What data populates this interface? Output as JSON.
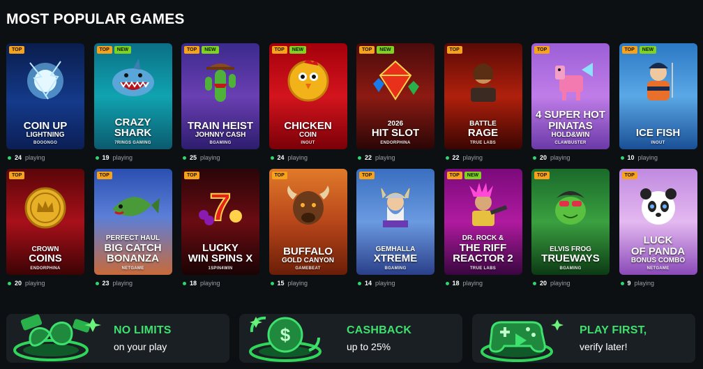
{
  "section_title": "MOST POPULAR GAMES",
  "games": [
    {
      "lines": [
        {
          "t": "COIN UP",
          "s": "lg"
        },
        {
          "t": "LIGHTNING",
          "s": "sm"
        }
      ],
      "provider": "BOOONGO",
      "players": "24",
      "badges": [
        "TOP"
      ],
      "bg": "linear-gradient(180deg,#0a1d4d,#143a8a 55%,#0b1e55)",
      "art": "lightning",
      "icon": "lightning-orb-icon"
    },
    {
      "lines": [
        {
          "t": "CRAZY",
          "s": "lg"
        },
        {
          "t": "SHARK",
          "s": "lg"
        }
      ],
      "provider": "7RINGS GAMING",
      "players": "19",
      "badges": [
        "TOP",
        "NEW"
      ],
      "bg": "linear-gradient(180deg,#0b6f86,#10a3b0 50%,#0b5a6e)",
      "art": "shark",
      "icon": "shark-icon"
    },
    {
      "lines": [
        {
          "t": "TRAIN HEIST",
          "s": "lg"
        },
        {
          "t": "JOHNNY CASH",
          "s": "sm"
        }
      ],
      "provider": "BGAMING",
      "players": "25",
      "badges": [
        "TOP",
        "NEW"
      ],
      "bg": "linear-gradient(180deg,#3b2a8c,#6a3fb2 50%,#2d1d6e)",
      "art": "cactus",
      "icon": "cactus-cowboy-icon"
    },
    {
      "lines": [
        {
          "t": "CHICKEN",
          "s": "lg"
        },
        {
          "t": "COIN",
          "s": "sm"
        }
      ],
      "provider": "INOUT",
      "players": "24",
      "badges": [
        "TOP",
        "NEW"
      ],
      "bg": "linear-gradient(180deg,#a3000c,#d4141d 50%,#7a0008)",
      "art": "chicken",
      "icon": "chicken-coin-icon"
    },
    {
      "lines": [
        {
          "t": "2026",
          "s": "sm"
        },
        {
          "t": "HIT SLOT",
          "s": "lg"
        }
      ],
      "provider": "ENDORPHINA",
      "players": "22",
      "badges": [
        "TOP",
        "NEW"
      ],
      "bg": "linear-gradient(180deg,#4a0b0b,#8c1a12 50%,#2a0606)",
      "art": "gems",
      "icon": "diamond-gems-icon"
    },
    {
      "lines": [
        {
          "t": "BATTLE",
          "s": "sm"
        },
        {
          "t": "RAGE",
          "s": "lg"
        }
      ],
      "provider": "TRUE LABS",
      "players": "22",
      "badges": [
        "TOP"
      ],
      "bg": "linear-gradient(180deg,#5a0a06,#b0200c 50%,#3a0502)",
      "art": "warrior",
      "icon": "warrior-icon"
    },
    {
      "lines": [
        {
          "t": "4 SUPER HOT",
          "s": "lg"
        },
        {
          "t": "PINATAS",
          "s": "lg"
        },
        {
          "t": "HOLD&WIN",
          "s": "sm"
        }
      ],
      "provider": "CLAWBUSTER",
      "players": "20",
      "badges": [
        "TOP"
      ],
      "bg": "linear-gradient(180deg,#9b5fd6,#c07de8 50%,#6a3aa8)",
      "art": "pinata",
      "icon": "pinata-icon"
    },
    {
      "lines": [
        {
          "t": "ICE FISH",
          "s": "lg"
        }
      ],
      "provider": "INOUT",
      "players": "10",
      "badges": [
        "TOP",
        "NEW"
      ],
      "bg": "linear-gradient(180deg,#2b78c4,#5aa8e6 50%,#1a4f96)",
      "art": "icefish",
      "icon": "ice-fisher-icon"
    },
    {
      "lines": [
        {
          "t": "CROWN",
          "s": "sm"
        },
        {
          "t": "COINS",
          "s": "lg"
        }
      ],
      "provider": "ENDORPHINA",
      "players": "20",
      "badges": [
        "TOP"
      ],
      "bg": "linear-gradient(180deg,#5a0608,#a8101a 50%,#3c0304)",
      "art": "crowncoin",
      "icon": "crown-coin-icon"
    },
    {
      "lines": [
        {
          "t": "PERFECT HAUL",
          "s": "sm"
        },
        {
          "t": "BIG CATCH",
          "s": "lg"
        },
        {
          "t": "BONANZA",
          "s": "lg"
        }
      ],
      "provider": "NETGAME",
      "players": "23",
      "badges": [
        "TOP"
      ],
      "bg": "linear-gradient(180deg,#2a4fb0,#5b7fd8 45%,#c86a3a)",
      "art": "fish",
      "icon": "bass-fish-icon"
    },
    {
      "lines": [
        {
          "t": "LUCKY",
          "s": "lg"
        },
        {
          "t": "WIN SPINS X",
          "s": "lg"
        }
      ],
      "provider": "1SPIN4WIN",
      "players": "18",
      "badges": [
        "TOP"
      ],
      "bg": "linear-gradient(180deg,#2a0508,#6a0c12 50%,#1a0304)",
      "art": "seven",
      "icon": "lucky-seven-icon"
    },
    {
      "lines": [
        {
          "t": "BUFFALO",
          "s": "lg"
        },
        {
          "t": "GOLD CANYON",
          "s": "sm"
        }
      ],
      "provider": "GAMEBEAT",
      "players": "15",
      "badges": [
        "TOP"
      ],
      "bg": "linear-gradient(180deg,#e07a2a,#b8461a 50%,#6a1e08)",
      "art": "buffalo",
      "icon": "buffalo-icon"
    },
    {
      "lines": [
        {
          "t": "GEMHALLA",
          "s": "sm"
        },
        {
          "t": "XTREME",
          "s": "lg"
        }
      ],
      "provider": "BGAMING",
      "players": "14",
      "badges": [
        "TOP"
      ],
      "bg": "linear-gradient(180deg,#3a6fc0,#6a9ae0 50%,#2a3f8a)",
      "art": "viking",
      "icon": "viking-icon"
    },
    {
      "lines": [
        {
          "t": "DR. ROCK &",
          "s": "sm"
        },
        {
          "t": "THE RIFF",
          "s": "lg"
        },
        {
          "t": "REACTOR 2",
          "s": "lg"
        }
      ],
      "provider": "TRUE LABS",
      "players": "18",
      "badges": [
        "TOP",
        "NEW"
      ],
      "bg": "linear-gradient(180deg,#7a0a7a,#b01aa0 50%,#3a0640)",
      "art": "rocker",
      "icon": "rocker-icon"
    },
    {
      "lines": [
        {
          "t": "ELVIS FROG",
          "s": "sm"
        },
        {
          "t": "TRUEWAYS",
          "s": "lg"
        }
      ],
      "provider": "BGAMING",
      "players": "20",
      "badges": [
        "TOP"
      ],
      "bg": "linear-gradient(180deg,#1a6a2a,#3aa040 50%,#0c3a14)",
      "art": "frog",
      "icon": "elvis-frog-icon"
    },
    {
      "lines": [
        {
          "t": "LUCK",
          "s": "lg"
        },
        {
          "t": "OF PANDA",
          "s": "lg"
        },
        {
          "t": "BONUS COMBO",
          "s": "sm"
        }
      ],
      "provider": "NETGAME",
      "players": "9",
      "badges": [
        "TOP"
      ],
      "bg": "linear-gradient(180deg,#c08ae0,#e4b8f0 50%,#8a4ab8)",
      "art": "panda",
      "icon": "panda-icon"
    }
  ],
  "playing_label": "playing",
  "promos": [
    {
      "title": "NO LIMITS",
      "subtitle": "on your play",
      "icon": "infinity-icon"
    },
    {
      "title": "CASHBACK",
      "subtitle": "up to 25%",
      "icon": "dollar-coin-icon"
    },
    {
      "title": "PLAY FIRST,",
      "subtitle": "verify later!",
      "icon": "gamepad-icon"
    }
  ],
  "colors": {
    "accent_green": "#3ee06e",
    "badge_top": "#f6a21b",
    "badge_new": "#7ed321",
    "background": "#0d1013",
    "card": "#1a1f23"
  }
}
